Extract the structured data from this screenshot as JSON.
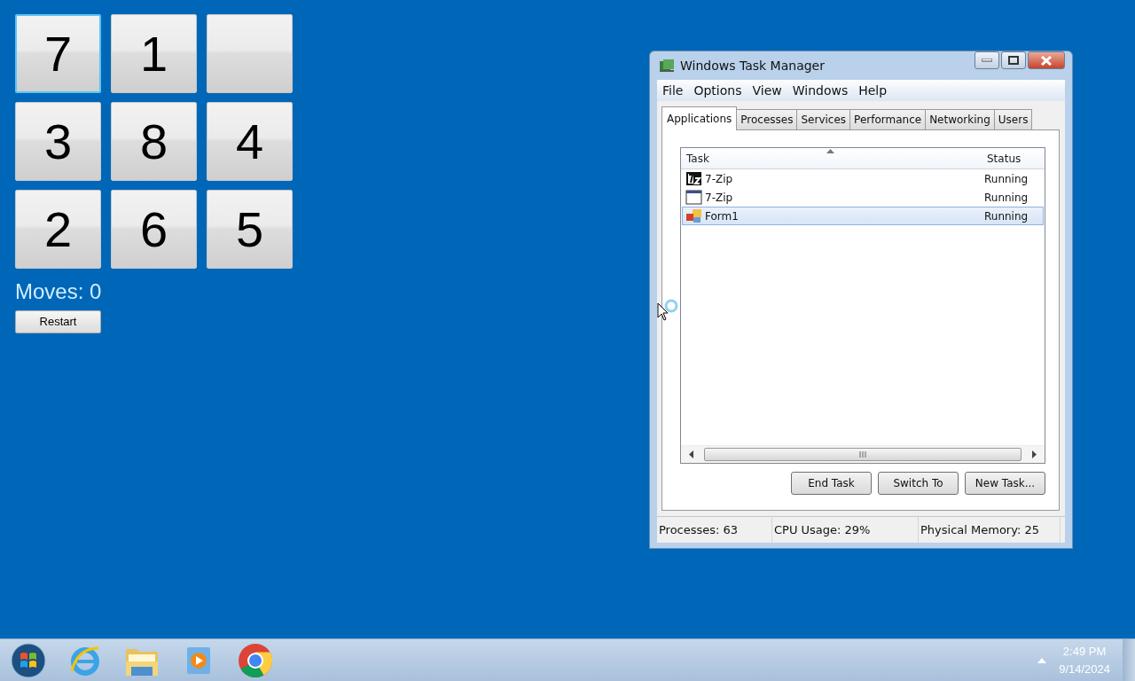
{
  "puzzle": {
    "tiles": [
      {
        "kind": "number",
        "label": "7",
        "focused": true
      },
      {
        "kind": "number",
        "label": "1",
        "focused": false
      },
      {
        "kind": "blank",
        "focused": false
      },
      {
        "kind": "number",
        "label": "3",
        "focused": false
      },
      {
        "kind": "number",
        "label": "8",
        "focused": false
      },
      {
        "kind": "number",
        "label": "4",
        "focused": false
      },
      {
        "kind": "number",
        "label": "2",
        "focused": false
      },
      {
        "kind": "number",
        "label": "6",
        "focused": false
      },
      {
        "kind": "number",
        "label": "5",
        "focused": false
      }
    ],
    "moves": "Moves: 0",
    "restart": "Restart"
  },
  "task_manager": {
    "title": "Windows Task Manager",
    "menu": [
      "File",
      "Options",
      "View",
      "Windows",
      "Help"
    ],
    "tabs": [
      {
        "label": "Applications",
        "selected": true
      },
      {
        "label": "Processes",
        "selected": false
      },
      {
        "label": "Services",
        "selected": false
      },
      {
        "label": "Performance",
        "selected": false
      },
      {
        "label": "Networking",
        "selected": false
      },
      {
        "label": "Users",
        "selected": false
      }
    ],
    "columns": [
      "Task",
      "Status"
    ],
    "rows": [
      {
        "kind": "sevenzip",
        "task": "7-Zip",
        "status": "Running",
        "selected": false
      },
      {
        "kind": "window",
        "task": "7-Zip",
        "status": "Running",
        "selected": false
      },
      {
        "kind": "form",
        "task": "Form1",
        "status": "Running",
        "selected": true
      }
    ],
    "buttons": [
      "End Task",
      "Switch To",
      "New Task..."
    ],
    "status_bar": [
      "Processes: 63",
      "CPU Usage: 29%",
      "Physical Memory: 25"
    ]
  },
  "taskbar": {
    "time": "2:49 PM",
    "date": "9/14/2024"
  }
}
